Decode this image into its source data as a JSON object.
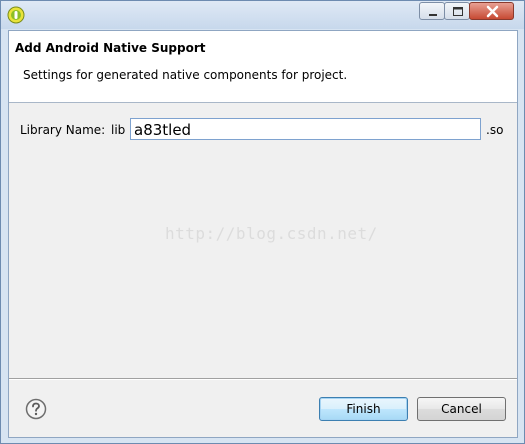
{
  "window": {
    "icon": "android-logo-icon",
    "controls": [
      "minimize-icon",
      "maximize-icon",
      "close-icon"
    ]
  },
  "header": {
    "title": "Add Android Native Support",
    "description": "Settings for generated native components for project."
  },
  "form": {
    "library_label": "Library Name:",
    "prefix": "lib",
    "library_value": "a83tled",
    "suffix": ".so"
  },
  "watermark": "http://blog.csdn.net/",
  "footer": {
    "help_icon": "help-icon",
    "finish_label": "Finish",
    "cancel_label": "Cancel"
  },
  "colors": {
    "header_bg": "#ffffff",
    "dialog_bg": "#f0f0f0",
    "frame": "#d7e4f2",
    "input_border": "#7ea2cf",
    "default_button": "#3c7fb1",
    "close_button": "#c74a33"
  }
}
